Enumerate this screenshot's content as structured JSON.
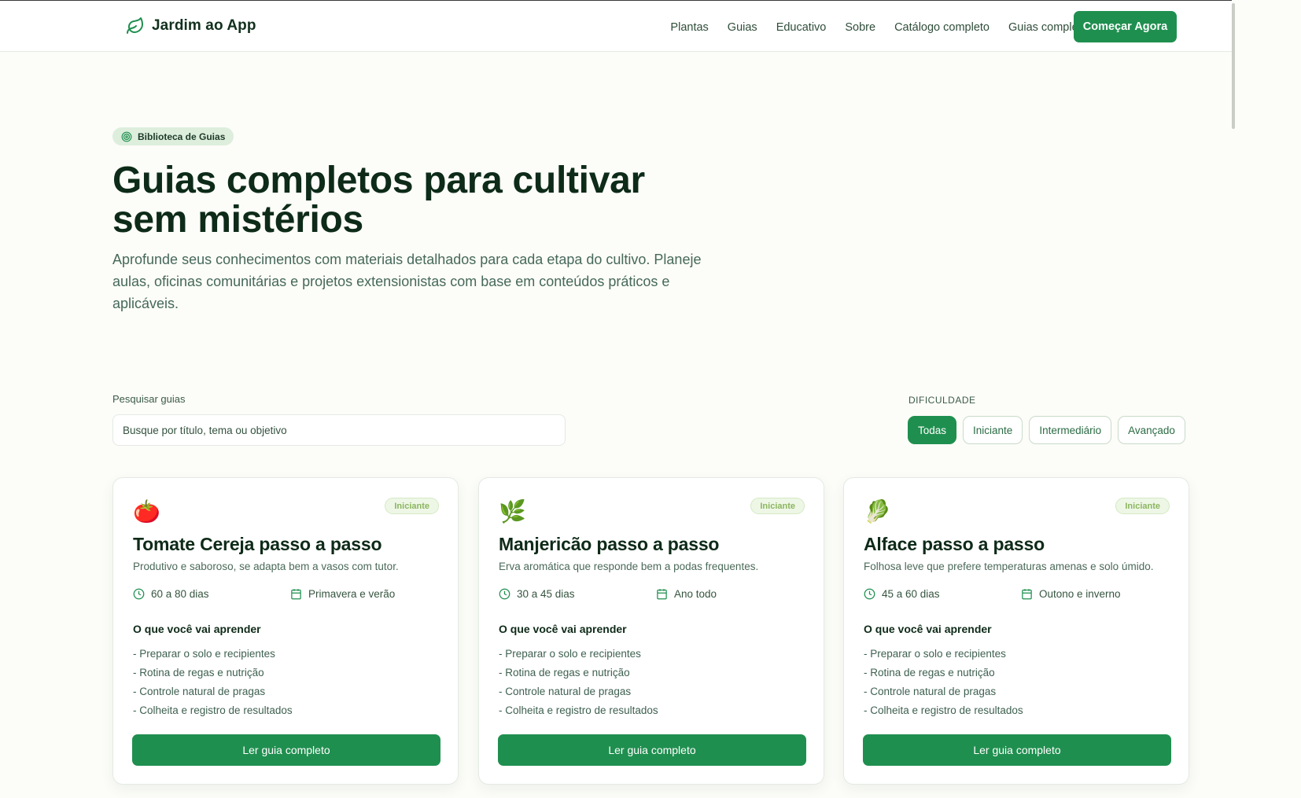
{
  "header": {
    "brand": "Jardim ao App",
    "nav": [
      "Plantas",
      "Guias",
      "Educativo",
      "Sobre",
      "Catálogo completo",
      "Guias completos"
    ],
    "cta": "Começar Agora"
  },
  "hero": {
    "badge": "Biblioteca de Guias",
    "title": "Guias completos para cultivar sem mistérios",
    "description": "Aprofunde seus conhecimentos com materiais detalhados para cada etapa do cultivo. Planeje aulas, oficinas comunitárias e projetos extensionistas com base em conteúdos práticos e aplicáveis."
  },
  "search": {
    "label": "Pesquisar guias",
    "placeholder": "Busque por título, tema ou objetivo",
    "value": ""
  },
  "difficulty": {
    "label": "DIFICULDADE",
    "options": [
      "Todas",
      "Iniciante",
      "Intermediário",
      "Avançado"
    ],
    "selected": "Todas"
  },
  "cards": [
    {
      "emoji": "🍅",
      "level": "Iniciante",
      "title": "Tomate Cereja passo a passo",
      "description": "Produtivo e saboroso, se adapta bem a vasos com tutor.",
      "duration": "60 a 80 dias",
      "season": "Primavera e verão",
      "learn_title": "O que você vai aprender",
      "learn": [
        "- Preparar o solo e recipientes",
        "- Rotina de regas e nutrição",
        "- Controle natural de pragas",
        "- Colheita e registro de resultados"
      ],
      "button": "Ler guia completo"
    },
    {
      "emoji": "🌿",
      "level": "Iniciante",
      "title": "Manjericão passo a passo",
      "description": "Erva aromática que responde bem a podas frequentes.",
      "duration": "30 a 45 dias",
      "season": "Ano todo",
      "learn_title": "O que você vai aprender",
      "learn": [
        "- Preparar o solo e recipientes",
        "- Rotina de regas e nutrição",
        "- Controle natural de pragas",
        "- Colheita e registro de resultados"
      ],
      "button": "Ler guia completo"
    },
    {
      "emoji": "🥬",
      "level": "Iniciante",
      "title": "Alface passo a passo",
      "description": "Folhosa leve que prefere temperaturas amenas e solo úmido.",
      "duration": "45 a 60 dias",
      "season": "Outono e inverno",
      "learn_title": "O que você vai aprender",
      "learn": [
        "- Preparar o solo e recipientes",
        "- Rotina de regas e nutrição",
        "- Controle natural de pragas",
        "- Colheita e registro de resultados"
      ],
      "button": "Ler guia completo"
    }
  ],
  "icons": {
    "brand": "leaf-icon",
    "badge": "target-icon",
    "duration": "clock-icon",
    "season": "calendar-icon"
  },
  "colors": {
    "primary": "#1f8f4f",
    "heading": "#0d2b18",
    "background": "#fcfcf8"
  }
}
